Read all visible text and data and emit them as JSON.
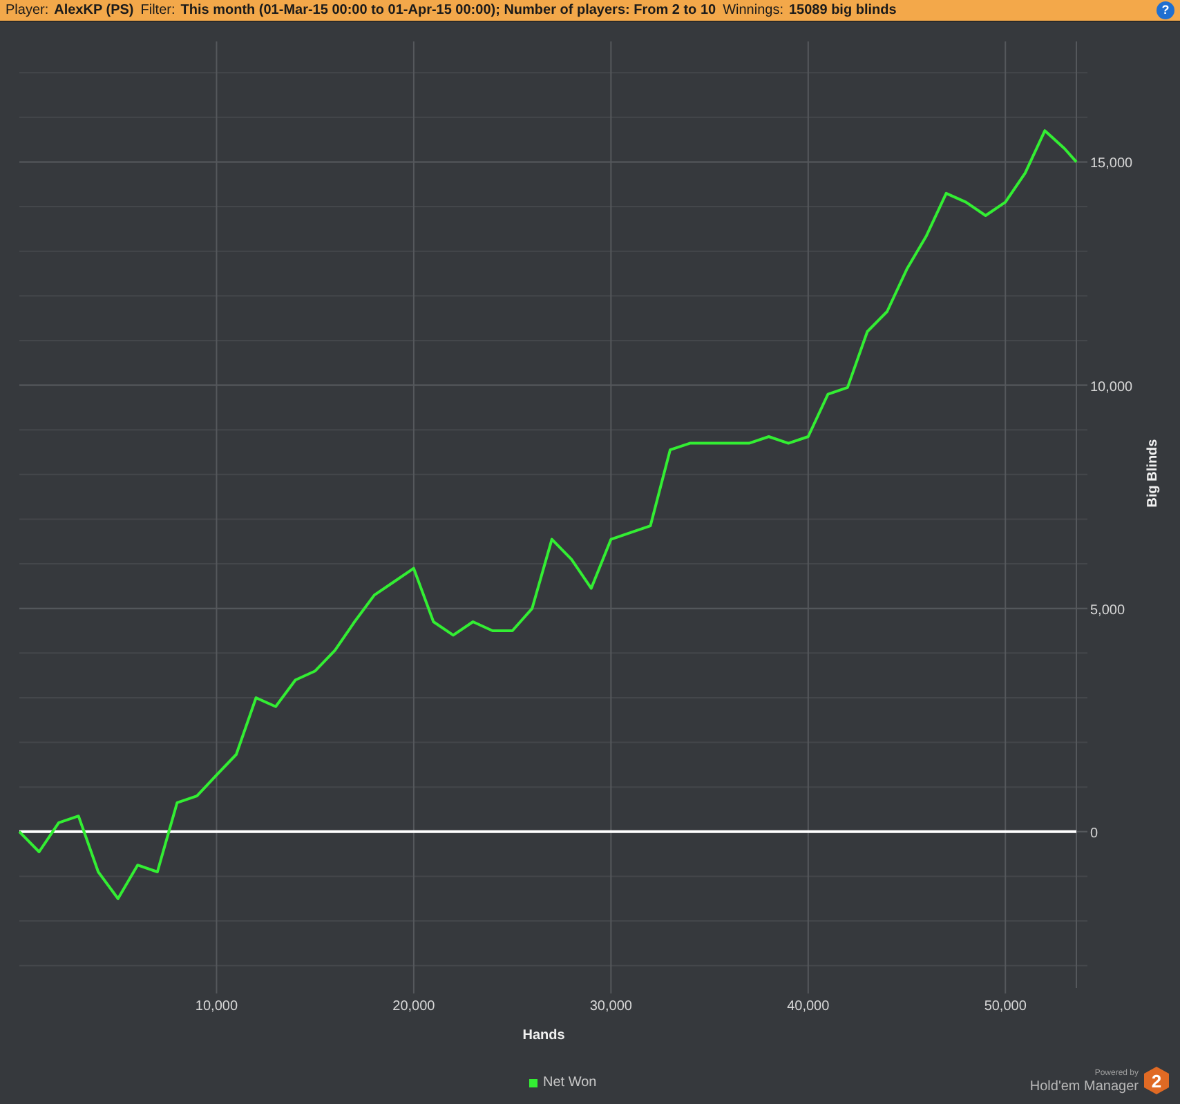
{
  "header": {
    "fields": [
      {
        "label": "Player:",
        "value": "AlexKP (PS)"
      },
      {
        "label": "Filter:",
        "value": "This month (01-Mar-15 00:00 to 01-Apr-15 00:00); Number of players: From 2 to 10"
      },
      {
        "label": "Winnings:",
        "value": "15089 big blinds"
      }
    ],
    "help": "?"
  },
  "chart": {
    "chart_data": {
      "type": "line",
      "grid": true,
      "xlabel": "Hands",
      "ylabel": "Big Blinds",
      "xlim": [
        0,
        53600
      ],
      "ylim": [
        -3500,
        17700
      ],
      "xticks": [
        {
          "value": 10000,
          "label": "10,000"
        },
        {
          "value": 20000,
          "label": "20,000"
        },
        {
          "value": 30000,
          "label": "30,000"
        },
        {
          "value": 40000,
          "label": "40,000"
        },
        {
          "value": 50000,
          "label": "50,000"
        }
      ],
      "yticks": [
        {
          "value": 0,
          "label": "0"
        },
        {
          "value": 5000,
          "label": "5,000"
        },
        {
          "value": 10000,
          "label": "10,000"
        },
        {
          "value": 15000,
          "label": "15,000"
        }
      ],
      "x": [
        0,
        1000,
        2000,
        3000,
        4000,
        5000,
        6000,
        7000,
        8000,
        9000,
        10000,
        11000,
        12000,
        13000,
        14000,
        15000,
        16000,
        17000,
        18000,
        19000,
        20000,
        21000,
        22000,
        23000,
        24000,
        25000,
        26000,
        27000,
        28000,
        29000,
        30000,
        31000,
        32000,
        33000,
        34000,
        35000,
        36000,
        37000,
        38000,
        39000,
        40000,
        41000,
        42000,
        43000,
        44000,
        45000,
        46000,
        47000,
        48000,
        49000,
        50000,
        51000,
        52000,
        53000,
        53600
      ],
      "series": [
        {
          "name": "Net Won",
          "color": "#33ee33",
          "values": [
            0,
            -450,
            200,
            350,
            -900,
            -1500,
            -750,
            -900,
            650,
            800,
            1270,
            1730,
            3000,
            2800,
            3400,
            3600,
            4060,
            4700,
            5300,
            5600,
            5900,
            4700,
            4400,
            4700,
            4500,
            4500,
            5000,
            6550,
            6100,
            5450,
            6550,
            6700,
            6850,
            8550,
            8700,
            8700,
            8700,
            8700,
            8850,
            8700,
            8850,
            9800,
            9950,
            11200,
            11650,
            12600,
            13350,
            14300,
            14100,
            13800,
            14100,
            14750,
            15700,
            15300,
            15000
          ]
        }
      ]
    }
  },
  "branding": {
    "caption": "Powered by",
    "product": "Hold'em Manager",
    "badge": "2"
  }
}
